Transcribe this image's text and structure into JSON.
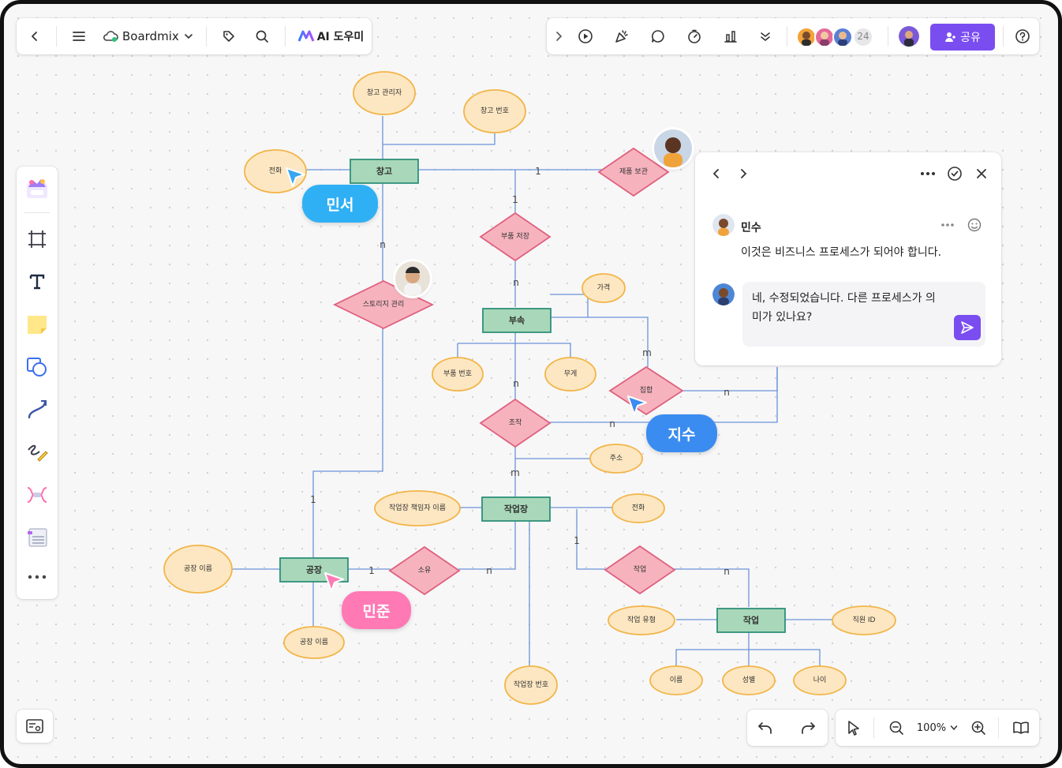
{
  "colors": {
    "entity_fill": "#a8d8b9",
    "entity_stroke": "#2f8f7a",
    "attr_fill": "#fde7c2",
    "attr_stroke": "#f2b548",
    "rel_fill": "#f6b3be",
    "rel_stroke": "#e0607e",
    "line": "#6c93d8",
    "share_button": "#7a4df0",
    "cursor_blue": "#3aa6f0",
    "cursor_pink": "#ff79b5"
  },
  "toolbar": {
    "app_name": "Boardmix",
    "ai_label": "AI 도우미",
    "collaborator_count": "24",
    "share_label": "공유"
  },
  "cursors": {
    "minseo": "민서",
    "jisu": "지수",
    "minjun": "민준"
  },
  "comment_panel": {
    "author": "민수",
    "comment": "이것은 비즈니스 프로세스가 되어야 합니다.",
    "reply_line1": "네, 수정되었습니다. 다른 프로세스가 의",
    "reply_line2": "미가 있나요?"
  },
  "bottom_toolbar": {
    "zoom": "100%"
  },
  "diagram": {
    "entities": [
      {
        "id": "e_warehouse",
        "label": "창고"
      },
      {
        "id": "e_dept",
        "label": "부속"
      },
      {
        "id": "e_workshop",
        "label": "작업장"
      },
      {
        "id": "e_factory",
        "label": "공장"
      },
      {
        "id": "e_work",
        "label": "작업"
      }
    ],
    "attributes": [
      {
        "id": "a_wh_manager",
        "label": "창고 관리자"
      },
      {
        "id": "a_wh_no",
        "label": "창고 번호"
      },
      {
        "id": "a_wh_phone",
        "label": "전화"
      },
      {
        "id": "a_price",
        "label": "가격"
      },
      {
        "id": "a_part_no",
        "label": "부품 번호"
      },
      {
        "id": "a_weight",
        "label": "무게"
      },
      {
        "id": "a_addr",
        "label": "주소"
      },
      {
        "id": "a_ws_mgr",
        "label": "작업장 책임자 이름"
      },
      {
        "id": "a_ws_phone",
        "label": "전화"
      },
      {
        "id": "a_factory_name",
        "label": "공장 이름"
      },
      {
        "id": "a_factory_name2",
        "label": "공장 이름"
      },
      {
        "id": "a_ws_no",
        "label": "작업장 번호"
      },
      {
        "id": "a_work_type",
        "label": "작업 유형"
      },
      {
        "id": "a_emp_id",
        "label": "직원 ID"
      },
      {
        "id": "a_name",
        "label": "이름"
      },
      {
        "id": "a_gender",
        "label": "성별"
      },
      {
        "id": "a_age",
        "label": "나이"
      }
    ],
    "relationships": [
      {
        "id": "r_product",
        "label": "제품 보관"
      },
      {
        "id": "r_partstore",
        "label": "부품 저장"
      },
      {
        "id": "r_story",
        "label": "스토리지 관리"
      },
      {
        "id": "r_set",
        "label": "집합"
      },
      {
        "id": "r_make",
        "label": "조작"
      },
      {
        "id": "r_own",
        "label": "소유"
      },
      {
        "id": "r_work",
        "label": "작업"
      }
    ],
    "cardinalities": {
      "c1": "1",
      "c2": "1",
      "c3": "n",
      "c4": "n",
      "c5": "m",
      "c6": "n",
      "c7": "n",
      "c8": "n",
      "c9": "m",
      "c10": "1",
      "c11": "1",
      "c12": "n",
      "c13": "1",
      "c14": "n"
    }
  }
}
